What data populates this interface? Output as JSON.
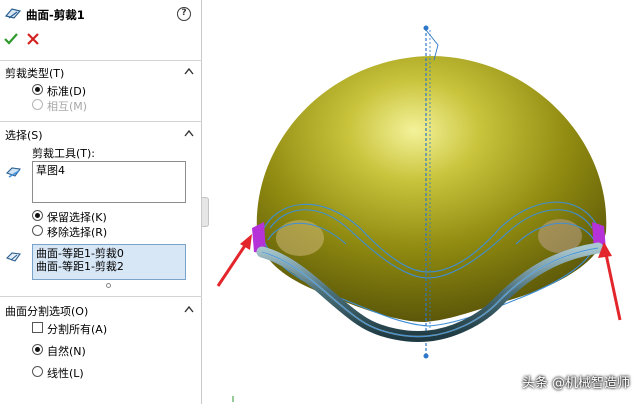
{
  "title": "曲面-剪裁1",
  "help_glyph": "?",
  "trim_type": {
    "title": "剪裁类型(T)",
    "options": [
      {
        "label": "标准(D)",
        "selected": true,
        "enabled": true
      },
      {
        "label": "相互(M)",
        "selected": false,
        "enabled": false
      }
    ]
  },
  "selection": {
    "title": "选择(S)",
    "tool_label": "剪裁工具(T):",
    "tool_value": "草图4",
    "keep_options": [
      {
        "label": "保留选择(K)",
        "selected": true
      },
      {
        "label": "移除选择(R)",
        "selected": false
      }
    ],
    "bodies": [
      "曲面-等距1-剪裁0",
      "曲面-等距1-剪裁2"
    ]
  },
  "split": {
    "title": "曲面分割选项(O)",
    "split_all": {
      "label": "分割所有(A)",
      "checked": false
    },
    "options": [
      {
        "label": "自然(N)",
        "selected": true
      },
      {
        "label": "线性(L)",
        "selected": false
      }
    ]
  },
  "colors": {
    "dome": "#8f8a10",
    "accent_blue": "#3f8fd6",
    "trim_magenta": "#b531d8",
    "arrow_red": "#e2262b",
    "ok_green": "#2e9a2e",
    "cancel_red": "#d22222"
  },
  "icons": [
    "surface-trim-icon",
    "help-icon",
    "ok-check-icon",
    "cancel-x-icon",
    "collapse-chevron-icon",
    "trim-tool-icon",
    "face-select-icon"
  ],
  "watermark": "头条 @机械智造师"
}
